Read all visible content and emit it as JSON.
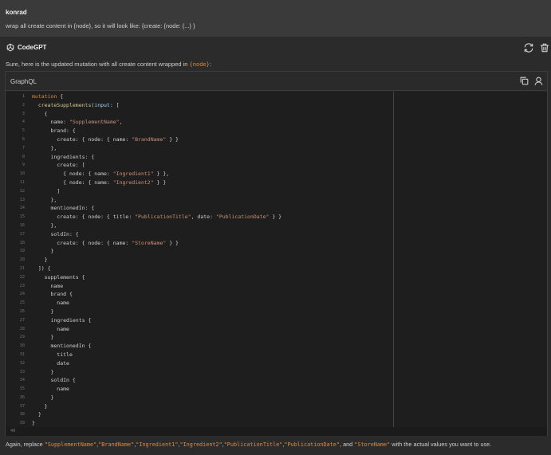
{
  "user": {
    "name": "konrad",
    "message": "wrap all create content in {node}, so it will look like: {create: {node: {...} }"
  },
  "bot": {
    "name": "CodeGPT",
    "intro_text": "Sure, here is the updated mutation with all create content wrapped in ",
    "intro_code": "{node}",
    "intro_end": ":"
  },
  "code_card": {
    "language": "GraphQL",
    "status": "48",
    "lines": [
      "mutation {",
      "  createSupplements(input: [",
      "    {",
      "      name: \"SupplementName\",",
      "      brand: {",
      "        create: { node: { name: \"BrandName\" } }",
      "      },",
      "      ingredients: {",
      "        create: [",
      "          { node: { name: \"Ingredient1\" } },",
      "          { node: { name: \"Ingredient2\" } }",
      "        ]",
      "      },",
      "      mentionedIn: {",
      "        create: { node: { title: \"PublicationTitle\", date: \"PublicationDate\" } }",
      "      },",
      "      soldIn: {",
      "        create: { node: { name: \"StoreName\" } }",
      "      }",
      "    }",
      "  ]) {",
      "    supplements {",
      "      name",
      "      brand {",
      "        name",
      "      }",
      "      ingredients {",
      "        name",
      "      }",
      "      mentionedIn {",
      "        title",
      "        date",
      "      }",
      "      soldIn {",
      "        name",
      "      }",
      "    }",
      "  }",
      "}"
    ]
  },
  "footer": {
    "prefix": "Again, replace ",
    "placeholders": [
      "\"SupplementName\"",
      "\"BrandName\"",
      "\"Ingredient1\"",
      "\"Ingredient2\"",
      "\"PublicationTitle\"",
      "\"PublicationDate\"",
      "\"StoreName\""
    ],
    "sep": ", ",
    "and": "and ",
    "suffix": " with the actual values you want to use."
  },
  "icons": {
    "regenerate": "refresh-icon",
    "delete": "trash-icon",
    "copy": "copy-icon",
    "insert": "insert-code-icon",
    "logo": "openai-logo-icon"
  },
  "colors": {
    "accent": "#e08a3a"
  }
}
